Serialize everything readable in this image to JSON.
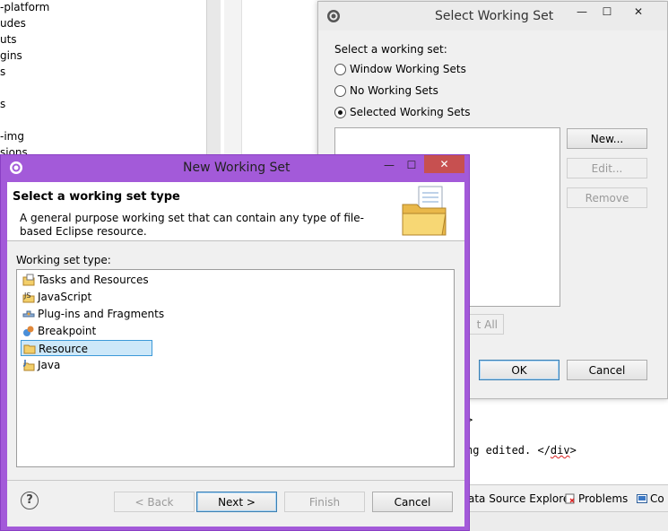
{
  "background": {
    "tree_lines": [
      "-platform",
      "udes",
      "uts",
      "gins",
      "s",
      "s",
      "-img",
      "sions"
    ],
    "code_lines": [
      ">",
      "ng edited. </div>"
    ],
    "squiggle_word": "div",
    "bottom_tabs": [
      "ata Source Explorer",
      "Problems",
      "Co"
    ]
  },
  "select_working_set": {
    "title": "Select Working Set",
    "minimize": "—",
    "maximize": "☐",
    "close": "✕",
    "prompt": "Select a working set:",
    "options": [
      "Window Working Sets",
      "No Working Sets",
      "Selected Working Sets"
    ],
    "selected_option": "Selected Working Sets",
    "buttons": {
      "new": "New...",
      "edit": "Edit...",
      "remove": "Remove",
      "select_all": "t All",
      "ok": "OK",
      "cancel": "Cancel"
    }
  },
  "new_working_set": {
    "title": "New Working Set",
    "minimize": "—",
    "maximize": "☐",
    "close": "✕",
    "heading": "Select a working set type",
    "description": "A general purpose working set that can contain any type of file-based Eclipse resource.",
    "type_label": "Working set type:",
    "types": [
      {
        "label": "Tasks and Resources",
        "icon": "tasks-icon"
      },
      {
        "label": "JavaScript",
        "icon": "javascript-icon"
      },
      {
        "label": "Plug-ins and Fragments",
        "icon": "plugin-icon"
      },
      {
        "label": "Breakpoint",
        "icon": "breakpoint-icon"
      },
      {
        "label": "Resource",
        "icon": "resource-folder-icon"
      },
      {
        "label": "Java",
        "icon": "java-icon"
      }
    ],
    "selected_type": "Resource",
    "help": "?",
    "buttons": {
      "back": "< Back",
      "next": "Next >",
      "finish": "Finish",
      "cancel": "Cancel"
    }
  },
  "colors": {
    "accent_title": "#a35ad9",
    "close_button": "#c75050",
    "selection": "#cde8f9"
  }
}
